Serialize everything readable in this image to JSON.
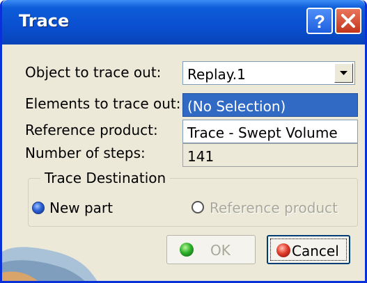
{
  "window": {
    "title": "Trace"
  },
  "titlebar": {
    "help_icon": "help-icon",
    "close_icon": "close-icon"
  },
  "form": {
    "object_label": "Object to trace out:",
    "object_value": "Replay.1",
    "elements_label": "Elements to trace out:",
    "elements_value": "(No Selection)",
    "reference_label": "Reference product:",
    "reference_value": "Trace - Swept Volume",
    "steps_label": "Number of steps:",
    "steps_value": "141"
  },
  "destination": {
    "legend": "Trace Destination",
    "options": [
      {
        "label": "New part",
        "selected": true,
        "enabled": true
      },
      {
        "label": "Reference product",
        "selected": false,
        "enabled": false
      }
    ]
  },
  "buttons": {
    "ok_label": "OK",
    "cancel_label": "Cancel"
  },
  "colors": {
    "titlebar": "#0a4fd0",
    "selection": "#316ac5",
    "dialog_bg": "#ece9d8"
  }
}
